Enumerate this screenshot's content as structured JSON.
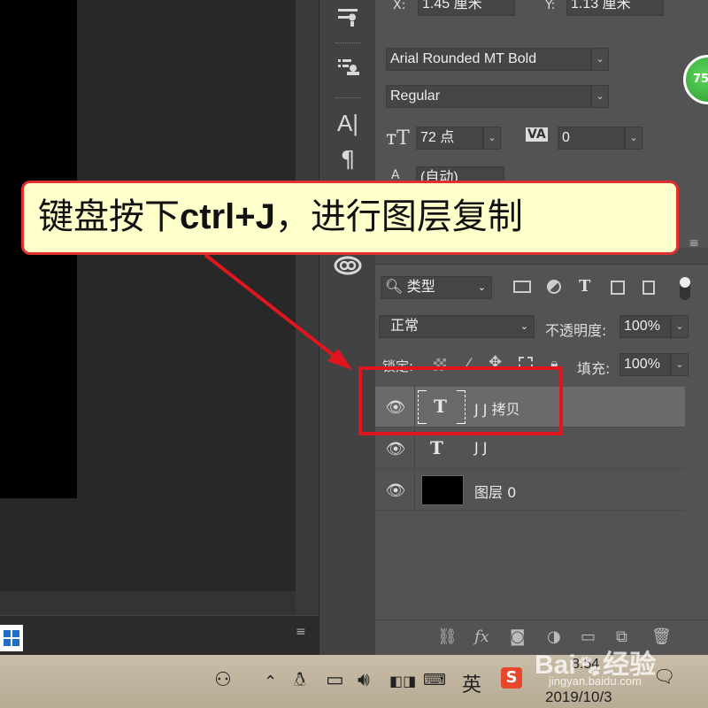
{
  "properties": {
    "x_label": "X:",
    "x_value": "1.45 厘米",
    "y_label": "Y:",
    "y_value": "1.13 厘米",
    "font_family": "Arial Rounded MT Bold",
    "font_style": "Regular",
    "size_value": "72 点",
    "tracking_value": "0",
    "leading_value": "(自动)",
    "badge_text": "75"
  },
  "callout": {
    "prefix": "键盘按下",
    "shortcut": "ctrl+J",
    "suffix": "，进行图层复制",
    "border_color": "#e03030",
    "fill_color": "#ffffcc"
  },
  "layers": {
    "filter_kind": "类型",
    "blend_mode": "正常",
    "opacity_label": "不透明度:",
    "opacity_value": "100%",
    "lock_label": "锁定:",
    "fill_label": "填充:",
    "fill_value": "100%",
    "rows": [
      {
        "name": "J J 拷贝",
        "type": "text",
        "selected": true
      },
      {
        "name": "J J",
        "type": "text",
        "selected": false
      },
      {
        "name": "图层 0",
        "type": "pixel",
        "selected": false
      }
    ]
  },
  "taskbar": {
    "ime_label": "英",
    "time": "8:54",
    "date": "2019/10/3"
  },
  "watermark": {
    "brand": "Bai",
    "brand_suffix": "经验",
    "url": "jingyan.baidu.com"
  },
  "icons": [
    "sliders-icon",
    "paragraph-style-icon",
    "character-icon",
    "paragraph-icon",
    "creative-cloud-icon",
    "eye-icon",
    "text-layer-icon",
    "link-icon",
    "fx-icon",
    "mask-icon",
    "adjustment-icon",
    "folder-icon",
    "new-layer-icon",
    "trash-icon"
  ]
}
